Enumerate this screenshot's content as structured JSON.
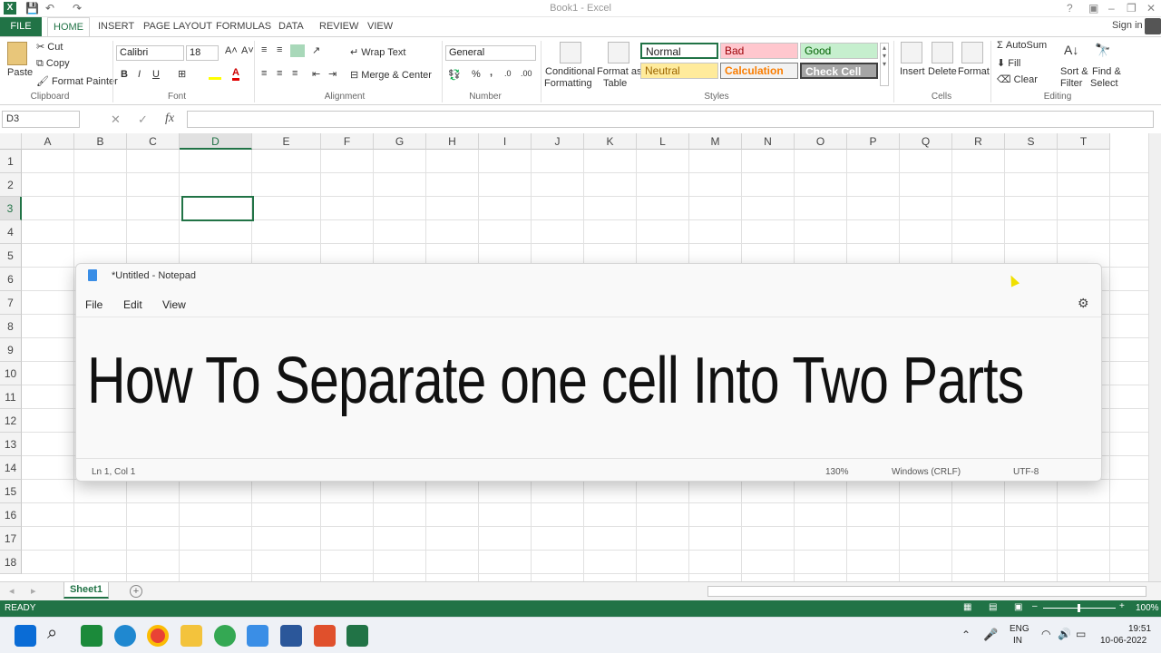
{
  "window": {
    "title": "Book1 - Excel",
    "help": "?",
    "sign_in": "Sign in"
  },
  "tabs": [
    "FILE",
    "HOME",
    "INSERT",
    "PAGE LAYOUT",
    "FORMULAS",
    "DATA",
    "REVIEW",
    "VIEW"
  ],
  "ribbon": {
    "clipboard": {
      "paste": "Paste",
      "cut": "Cut",
      "copy": "Copy",
      "format_painter": "Format Painter",
      "label": "Clipboard"
    },
    "font": {
      "name": "Calibri",
      "size": "18",
      "bold": "B",
      "italic": "I",
      "underline": "U",
      "label": "Font"
    },
    "alignment": {
      "wrap": "Wrap Text",
      "merge": "Merge & Center",
      "label": "Alignment"
    },
    "number": {
      "format": "General",
      "percent": "%",
      "comma": ",",
      "label": "Number"
    },
    "styles": {
      "cond1": "Conditional",
      "cond2": "Formatting",
      "fmt1": "Format as",
      "fmt2": "Table",
      "normal": "Normal",
      "bad": "Bad",
      "good": "Good",
      "neutral": "Neutral",
      "calculation": "Calculation",
      "check_cell": "Check Cell",
      "label": "Styles"
    },
    "cells": {
      "insert": "Insert",
      "delete": "Delete",
      "format": "Format",
      "label": "Cells"
    },
    "editing": {
      "autosum": "AutoSum",
      "fill": "Fill",
      "clear": "Clear",
      "sort1": "Sort &",
      "sort2": "Filter",
      "find1": "Find &",
      "find2": "Select",
      "label": "Editing"
    }
  },
  "formula_bar": {
    "name_box": "D3",
    "fx": "fx",
    "cancel": "✕",
    "enter": "✓"
  },
  "grid": {
    "columns": [
      "A",
      "B",
      "C",
      "D",
      "E",
      "F",
      "G",
      "H",
      "I",
      "J",
      "K",
      "L",
      "M",
      "N",
      "O",
      "P",
      "Q",
      "R",
      "S",
      "T"
    ],
    "rows": [
      "1",
      "2",
      "3",
      "4",
      "5",
      "6",
      "7",
      "8",
      "9",
      "10",
      "11",
      "12",
      "13",
      "14",
      "15",
      "16",
      "17",
      "18"
    ],
    "selected": "D3"
  },
  "sheet_tabs": {
    "active": "Sheet1",
    "add": "+"
  },
  "status": {
    "ready": "READY",
    "zoom": "100%"
  },
  "notepad": {
    "title": "*Untitled - Notepad",
    "menu": [
      "File",
      "Edit",
      "View"
    ],
    "content": "How To Separate one cell Into Two Parts",
    "status": {
      "position": "Ln 1, Col 1",
      "zoom": "130%",
      "line_ending": "Windows (CRLF)",
      "encoding": "UTF-8"
    }
  },
  "taskbar": {
    "lang1": "ENG",
    "lang2": "IN",
    "time": "19:51",
    "date": "10-06-2022"
  },
  "colors": {
    "excel_green": "#217346",
    "bad_bg": "#ffc7ce",
    "good_bg": "#c6efce",
    "neutral_bg": "#ffeb9c"
  }
}
